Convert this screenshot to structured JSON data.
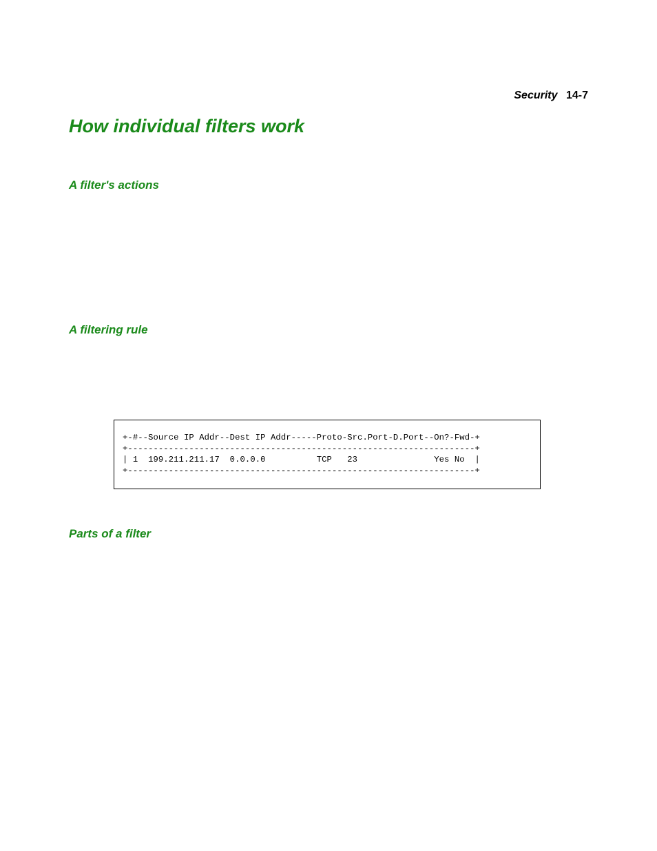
{
  "header": {
    "section": "Security",
    "page": "14-7"
  },
  "headings": {
    "main": "How individual filters work",
    "sub1": "A filter's actions",
    "sub2": "A filtering rule",
    "sub3": "Parts of a filter"
  },
  "table": {
    "line1": "+-#--Source IP Addr--Dest IP Addr-----Proto-Src.Port-D.Port--On?-Fwd-+",
    "line2": "+--------------------------------------------------------------------+",
    "line3": "| 1  199.211.211.17  0.0.0.0          TCP   23               Yes No  |",
    "line4": "+--------------------------------------------------------------------+"
  }
}
